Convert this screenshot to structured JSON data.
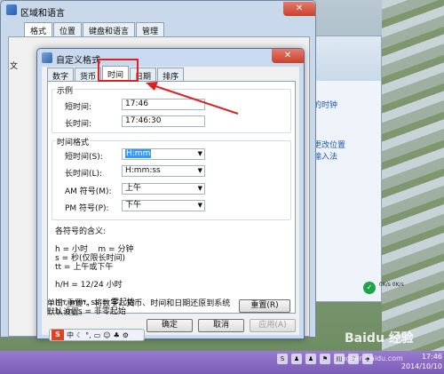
{
  "region_dialog": {
    "title": "区域和语言",
    "tabs": [
      "格式",
      "位置",
      "键盘和语言",
      "管理"
    ],
    "side_char": "文"
  },
  "control_panel": {
    "links": [
      "的时钟",
      "更改位置",
      "输入法"
    ],
    "status": "0K/s 0K/s"
  },
  "custom_format": {
    "title": "自定义格式",
    "close": "✕",
    "tabs": [
      "数字",
      "货币",
      "时间",
      "日期",
      "排序"
    ],
    "active_tab": "时间",
    "example_group": "示例",
    "short_time_label": "短时间:",
    "short_time_value": "17:46",
    "long_time_label": "长时间:",
    "long_time_value": "17:46:30",
    "format_group": "时间格式",
    "short_time_fmt_label": "短时间(S):",
    "short_time_fmt_value": "H:mm",
    "long_time_fmt_label": "长时间(L):",
    "long_time_fmt_value": "H:mm:ss",
    "am_label": "AM 符号(M):",
    "am_value": "上午",
    "pm_label": "PM 符号(P):",
    "pm_value": "下午",
    "notes": "各符号的含义:\n\nh = 小时    m = 分钟\ns = 秒(仅限长时间)\ntt = 上午或下午\n\nh/H = 12/24 小时\n\nhh, mm, ss = 零起始\nh, m, s = 非零起始",
    "reset_text": "单击\"重置\"，将数字、货币、时间和日期还原到系统\n默认设置。",
    "reset_button": "重置(R)",
    "ok_button": "确定",
    "cancel_button": "取消",
    "apply_button": "应用(A)"
  },
  "ime": {
    "logo": "S",
    "mode": "中"
  },
  "taskbar": {
    "time": "17:46",
    "date": "2014/10/10"
  },
  "watermark": {
    "text": "Baidu 经验",
    "sub": "jingyan.baidu.com"
  }
}
